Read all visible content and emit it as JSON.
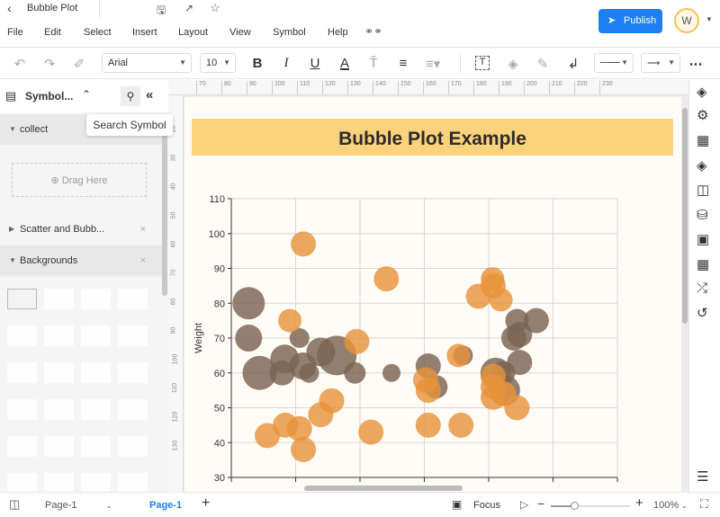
{
  "app": {
    "title": "Bubble Plot",
    "publish_label": "Publish",
    "avatar_initial": "W"
  },
  "menu": [
    "File",
    "Edit",
    "Select",
    "Insert",
    "Layout",
    "View",
    "Symbol",
    "Help"
  ],
  "toolbar": {
    "font": "Arial",
    "font_size": "10"
  },
  "left_panel": {
    "title": "Symbol...",
    "tooltip": "Search Symbol",
    "sections": [
      {
        "label": "collect"
      },
      {
        "label": "Scatter and Bubb..."
      },
      {
        "label": "Backgrounds"
      }
    ],
    "drag_label": "Drag Here"
  },
  "ruler": {
    "h": [
      "70",
      "80",
      "90",
      "100",
      "110",
      "120",
      "130",
      "140",
      "150",
      "160",
      "170",
      "180",
      "190",
      "200",
      "210",
      "220",
      "230"
    ],
    "v": [
      "20",
      "30",
      "40",
      "50",
      "60",
      "70",
      "80",
      "90",
      "100",
      "110",
      "120",
      "130"
    ]
  },
  "bottom": {
    "page_select": "Page-1",
    "page_tab": "Page-1",
    "focus": "Focus",
    "zoom": "100%"
  },
  "accent": "#1e7ff0",
  "chart_data": {
    "type": "scatter",
    "title": "Bubble Plot Example",
    "ylabel": "Weight",
    "xlabel": "",
    "ylim": [
      30,
      110
    ],
    "yticks": [
      "30",
      "40",
      "50",
      "60",
      "70",
      "80",
      "90",
      "100",
      "110"
    ],
    "xlim": [
      0,
      6
    ],
    "grid": true,
    "series": [
      {
        "color": "#7a6352",
        "points": [
          [
            0.27,
            80,
            18
          ],
          [
            0.27,
            70,
            15
          ],
          [
            0.44,
            60,
            19
          ],
          [
            0.79,
            60,
            14
          ],
          [
            0.83,
            64,
            16
          ],
          [
            1.06,
            70,
            11
          ],
          [
            1.11,
            62,
            15
          ],
          [
            1.21,
            60,
            11
          ],
          [
            1.39,
            66,
            16
          ],
          [
            1.64,
            65,
            22
          ],
          [
            1.92,
            60,
            12
          ],
          [
            2.49,
            60,
            10
          ],
          [
            3.06,
            62,
            14
          ],
          [
            3.18,
            56,
            13
          ],
          [
            3.6,
            65,
            11
          ],
          [
            4.11,
            60,
            17
          ],
          [
            4.23,
            60,
            13
          ],
          [
            4.25,
            55,
            17
          ],
          [
            4.44,
            75,
            13
          ],
          [
            4.39,
            70,
            14
          ],
          [
            4.48,
            71,
            14
          ],
          [
            4.48,
            63,
            14
          ],
          [
            4.74,
            75,
            14
          ]
        ]
      },
      {
        "color": "#e8923a",
        "points": [
          [
            1.12,
            97,
            14
          ],
          [
            2.41,
            87,
            14
          ],
          [
            0.91,
            75,
            13
          ],
          [
            1.95,
            69,
            14
          ],
          [
            1.56,
            52,
            14
          ],
          [
            1.39,
            48,
            14
          ],
          [
            0.84,
            45,
            14
          ],
          [
            1.06,
            44,
            14
          ],
          [
            0.56,
            42,
            14
          ],
          [
            1.12,
            38,
            14
          ],
          [
            2.17,
            43,
            14
          ],
          [
            3.02,
            58,
            14
          ],
          [
            3.06,
            55,
            14
          ],
          [
            3.06,
            45,
            14
          ],
          [
            3.53,
            65,
            13
          ],
          [
            3.57,
            45,
            14
          ],
          [
            4.06,
            87,
            13
          ],
          [
            4.07,
            85,
            14
          ],
          [
            3.84,
            82,
            14
          ],
          [
            4.19,
            81,
            13
          ],
          [
            4.07,
            59,
            14
          ],
          [
            4.07,
            56,
            14
          ],
          [
            4.07,
            53,
            14
          ],
          [
            4.23,
            54,
            14
          ],
          [
            4.44,
            50,
            14
          ]
        ]
      }
    ]
  }
}
